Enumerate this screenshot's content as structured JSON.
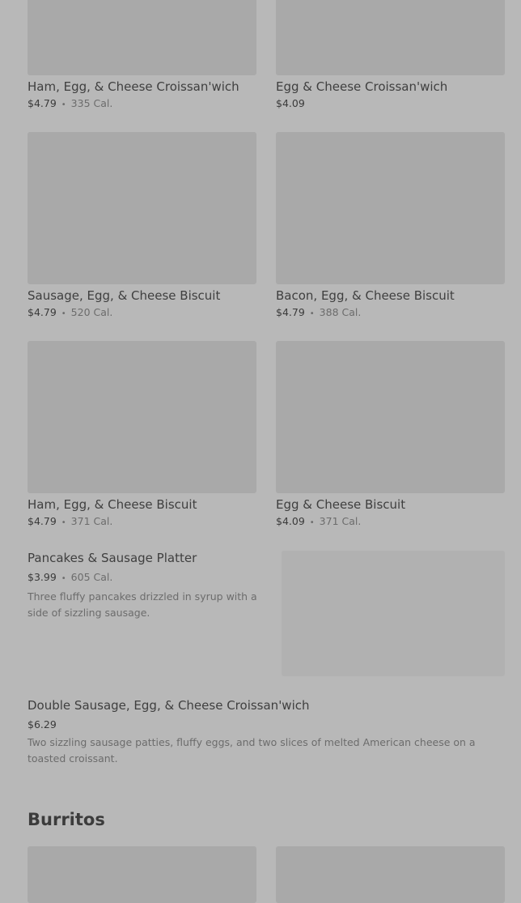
{
  "items": [
    {
      "name": "Ham, Egg, & Cheese Croissan'wich",
      "price": "$4.79",
      "sep": "•",
      "cal": "335 Cal."
    },
    {
      "name": "Egg & Cheese Croissan'wich",
      "price": "$4.09",
      "sep": "",
      "cal": ""
    },
    {
      "name": "Sausage, Egg, & Cheese Biscuit",
      "price": "$4.79",
      "sep": "•",
      "cal": "520 Cal."
    },
    {
      "name": "Bacon, Egg, & Cheese Biscuit",
      "price": "$4.79",
      "sep": "•",
      "cal": "388 Cal."
    },
    {
      "name": "Ham, Egg, & Cheese Biscuit",
      "price": "$4.79",
      "sep": "•",
      "cal": "371 Cal."
    },
    {
      "name": "Egg & Cheese Biscuit",
      "price": "$4.09",
      "sep": "•",
      "cal": "371 Cal."
    }
  ],
  "pancakes": {
    "name": "Pancakes & Sausage Platter",
    "price": "$3.99",
    "sep": "•",
    "cal": "605 Cal.",
    "desc": "Three fluffy pancakes drizzled in syrup with a side of sizzling sausage."
  },
  "double": {
    "name": "Double Sausage, Egg, & Cheese Croissan'wich",
    "price": "$6.29",
    "desc": "Two sizzling sausage patties, fluffy eggs, and two slices of melted American cheese on a toasted croissant."
  },
  "sections": {
    "burritos": "Burritos"
  }
}
